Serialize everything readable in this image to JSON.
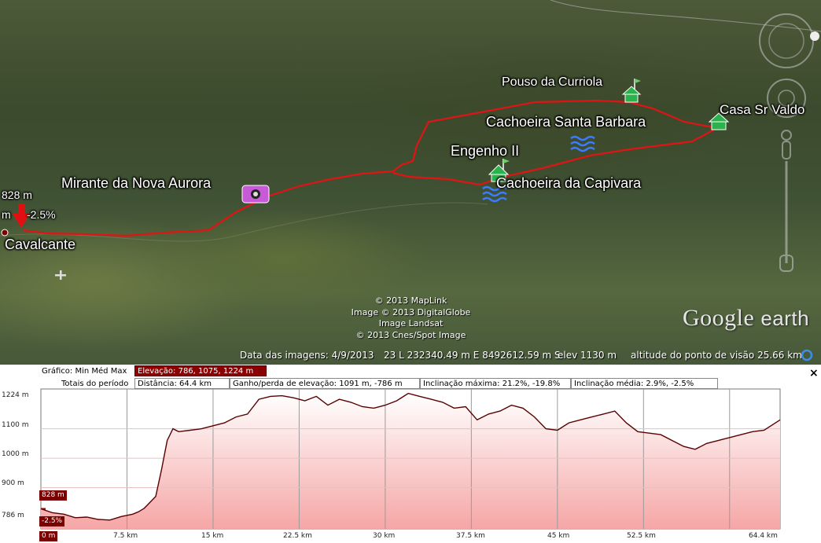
{
  "map": {
    "labels": {
      "pouso": "Pouso da Curriola",
      "santa_barbara": "Cachoeira Santa Barbara",
      "engenho": "Engenho II",
      "casa": "Casa Sr Valdo",
      "capivara": "Cachoeira da Capivara",
      "mirante": "Mirante da Nova Aurora",
      "cavalcante": "Cavalcante",
      "elev_marker": "828 m",
      "slope_unit": "m",
      "slope_marker": "-2.5%"
    },
    "copyright": [
      "© 2013 MapLink",
      "Image © 2013 DigitalGlobe",
      "Image Landsat",
      "© 2013 Cnes/Spot Image"
    ],
    "brand": {
      "google": "Google",
      "earth": "earth"
    },
    "status": {
      "date": "Data das imagens: 4/9/2013",
      "coords": "23 L 232340.49 m E 8492612.59 m S",
      "elev": "elev  1130 m",
      "eye_alt": "altitude do ponto de visão  25.66 km"
    },
    "icons": [
      "camera-icon",
      "house-flag-icon",
      "house-icon",
      "waterfall-icon",
      "airport-icon",
      "compass-icon",
      "navigation-control-icon",
      "red-arrow-marker-icon"
    ]
  },
  "profile": {
    "graph_label": "Gráfico",
    "stat_labels": [
      "Min",
      "Méd",
      "Max"
    ],
    "elevation": "Elevação: 786, 1075, 1224 m",
    "totals_label": "Totais do período",
    "distance": "Distância: 64.4 km",
    "gain": "Ganho/perda de elevação: 1091 m, -786 m",
    "max_slope": "Inclinação máxima: 21.2%, -19.8%",
    "avg_slope": "Inclinação média: 2.9%, -2.5%",
    "close": "×",
    "cursor_elev": "828 m",
    "cursor_slope": "-2.5%",
    "accent": "#8b0000"
  },
  "chart_data": {
    "type": "area",
    "xlabel": "",
    "ylabel": "",
    "xlim": [
      0,
      64.4
    ],
    "ylim": [
      786,
      1224
    ],
    "x_ticks": [
      "0 m",
      "7.5 km",
      "15 km",
      "22.5 km",
      "30 km",
      "37.5 km",
      "45 km",
      "52.5 km",
      "64.4 km"
    ],
    "y_ticks": [
      "1224 m",
      "1100 m",
      "1000 m",
      "900 m",
      "786 m"
    ],
    "x": [
      0,
      1,
      2,
      3,
      4,
      5,
      6,
      7,
      8,
      8.5,
      9,
      10,
      10.5,
      11,
      11.5,
      12,
      13,
      14,
      15,
      16,
      17,
      18,
      19,
      20,
      21,
      22,
      23,
      24,
      25,
      26,
      27,
      28,
      29,
      30,
      31,
      32,
      33,
      34,
      35,
      36,
      37,
      38,
      39,
      40,
      41,
      42,
      43,
      44,
      45,
      46,
      47,
      48,
      49,
      50,
      51,
      52,
      53,
      54,
      55,
      56,
      57,
      58,
      59,
      60,
      61,
      62,
      63,
      64.4
    ],
    "values": [
      828,
      815,
      810,
      798,
      800,
      792,
      790,
      802,
      810,
      818,
      830,
      870,
      960,
      1060,
      1100,
      1090,
      1095,
      1100,
      1110,
      1120,
      1140,
      1150,
      1200,
      1210,
      1212,
      1205,
      1195,
      1210,
      1180,
      1200,
      1190,
      1175,
      1170,
      1180,
      1195,
      1220,
      1210,
      1200,
      1190,
      1170,
      1175,
      1130,
      1150,
      1160,
      1180,
      1170,
      1140,
      1100,
      1095,
      1120,
      1130,
      1140,
      1150,
      1160,
      1120,
      1090,
      1085,
      1080,
      1060,
      1040,
      1030,
      1050,
      1060,
      1070,
      1080,
      1090,
      1095,
      1130
    ]
  }
}
